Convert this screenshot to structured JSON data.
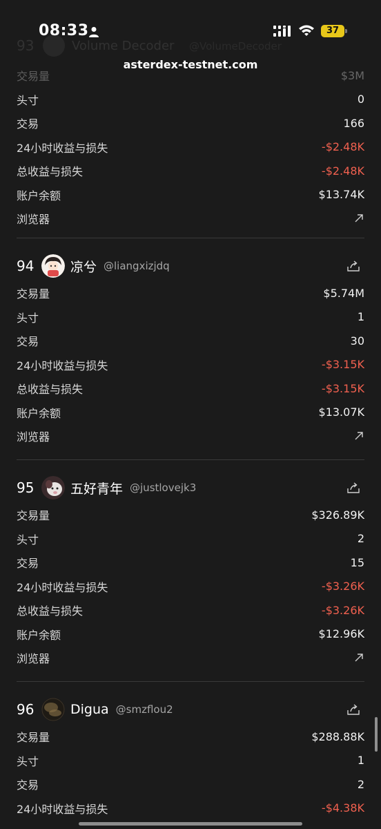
{
  "status_bar": {
    "time": "08:33",
    "battery": "37"
  },
  "browser": {
    "url": "asterdex-testnet.com"
  },
  "ghost_entry": {
    "rank": "93",
    "name": "Volume Decoder",
    "handle": "@VolumeDecoder"
  },
  "labels": {
    "volume": "交易量",
    "positions": "头寸",
    "trades": "交易",
    "pnl_24h": "24小时收益与损失",
    "pnl_total": "总收益与损失",
    "balance": "账户余额",
    "explorer": "浏览器"
  },
  "entry_93": {
    "volume": "$3M",
    "positions": "0",
    "trades": "166",
    "pnl_24h": "-$2.48K",
    "pnl_total": "-$2.48K",
    "balance": "$13.74K"
  },
  "entries": [
    {
      "rank": "94",
      "name": "凉兮",
      "handle": "@liangxizjdq",
      "volume": "$5.74M",
      "positions": "1",
      "trades": "30",
      "pnl_24h": "-$3.15K",
      "pnl_total": "-$3.15K",
      "balance": "$13.07K"
    },
    {
      "rank": "95",
      "name": "五好青年",
      "handle": "@justlovejk3",
      "volume": "$326.89K",
      "positions": "2",
      "trades": "15",
      "pnl_24h": "-$3.26K",
      "pnl_total": "-$3.26K",
      "balance": "$12.96K"
    },
    {
      "rank": "96",
      "name": "Digua",
      "handle": "@smzflou2",
      "volume": "$288.88K",
      "positions": "1",
      "trades": "2",
      "pnl_24h": "-$4.38K"
    }
  ],
  "colors": {
    "background": "#1b1b1b",
    "negative": "#f0604f",
    "divider": "#3a3a3a",
    "battery": "#e8c719"
  }
}
